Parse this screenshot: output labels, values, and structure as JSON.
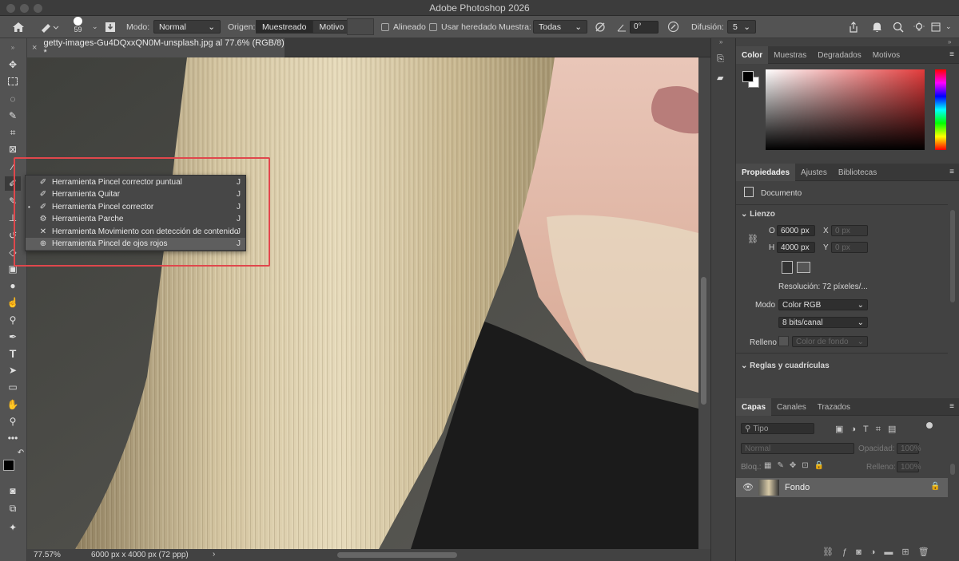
{
  "window": {
    "title": "Adobe Photoshop 2026"
  },
  "options_bar": {
    "brush_size": "59",
    "mode_label": "Modo:",
    "mode_value": "Normal",
    "source_label": "Origen:",
    "source_sampled": "Muestreado",
    "source_pattern": "Motivo",
    "aligned_label": "Alineado",
    "use_legacy_label": "Usar heredado",
    "sample_label": "Muestra:",
    "sample_value": "Todas",
    "angle_value": "0°",
    "diffusion_label": "Difusión:",
    "diffusion_value": "5"
  },
  "document": {
    "tab_title": "getty-images-Gu4DQxxQN0M-unsplash.jpg al 77.6% (RGB/8) *",
    "zoom": "77.57%",
    "doc_info": "6000 px x 4000 px (72 ppp)"
  },
  "tool_popup": {
    "items": [
      {
        "label": "Herramienta Pincel corrector puntual",
        "shortcut": "J"
      },
      {
        "label": "Herramienta Quitar",
        "shortcut": "J"
      },
      {
        "label": "Herramienta Pincel corrector",
        "shortcut": "J"
      },
      {
        "label": "Herramienta Parche",
        "shortcut": "J"
      },
      {
        "label": "Herramienta Movimiento con detección de contenido",
        "shortcut": "J"
      },
      {
        "label": "Herramienta Pincel de ojos rojos",
        "shortcut": "J"
      }
    ]
  },
  "color_panel": {
    "tabs": [
      "Color",
      "Muestras",
      "Degradados",
      "Motivos"
    ],
    "accent": "#e33b3b"
  },
  "properties_panel": {
    "tabs": [
      "Propiedades",
      "Ajustes",
      "Bibliotecas"
    ],
    "document_label": "Documento",
    "canvas_section": "Lienzo",
    "width_label": "O",
    "width_value": "6000 px",
    "height_label": "H",
    "height_value": "4000 px",
    "x_label": "X",
    "x_placeholder": "0 px",
    "y_label": "Y",
    "y_placeholder": "0 px",
    "resolution": "Resolución: 72 píxeles/...",
    "mode_label": "Modo",
    "mode_value": "Color RGB",
    "bits_value": "8 bits/canal",
    "fill_label": "Relleno",
    "fill_value": "Color de fondo",
    "rulers_section": "Reglas y cuadrículas"
  },
  "layers_panel": {
    "tabs": [
      "Capas",
      "Canales",
      "Trazados"
    ],
    "filter_placeholder": "Tipo",
    "blend_mode": "Normal",
    "opacity_label": "Opacidad:",
    "opacity_value": "100%",
    "lock_label": "Bloq.:",
    "fill_label": "Relleno:",
    "fill_value": "100%",
    "layers": [
      {
        "name": "Fondo"
      }
    ]
  }
}
